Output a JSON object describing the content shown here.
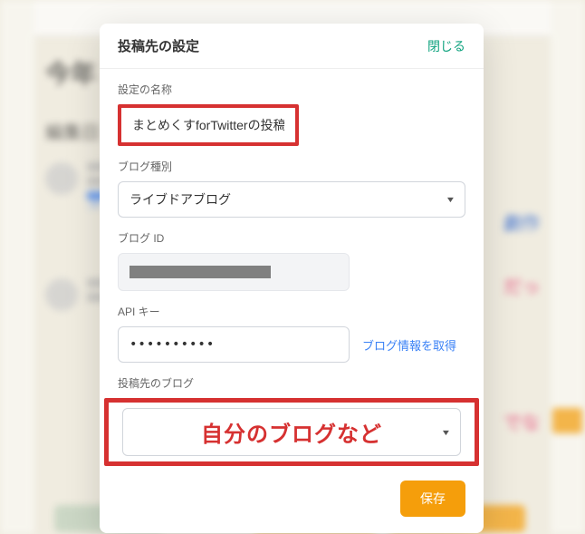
{
  "modal": {
    "title": "投稿先の設定",
    "close_label": "閉じる",
    "fields": {
      "name": {
        "label": "設定の名称",
        "value": "まとめくすforTwitterの投稿先"
      },
      "blog_type": {
        "label": "ブログ種別",
        "selected": "ライブドアブログ"
      },
      "blog_id": {
        "label": "ブログ ID"
      },
      "api_key": {
        "label": "API キー",
        "value": "••••••••••",
        "get_info_label": "ブログ情報を取得"
      },
      "dest_blog": {
        "label": "投稿先のブログ",
        "annotation": "自分のブログなど"
      }
    },
    "save_label": "保存"
  },
  "background": {
    "title": "今年",
    "sub": "編集日",
    "link1": "ス",
    "right1": "劇作",
    "right2": "だっ",
    "right3": "でな"
  }
}
